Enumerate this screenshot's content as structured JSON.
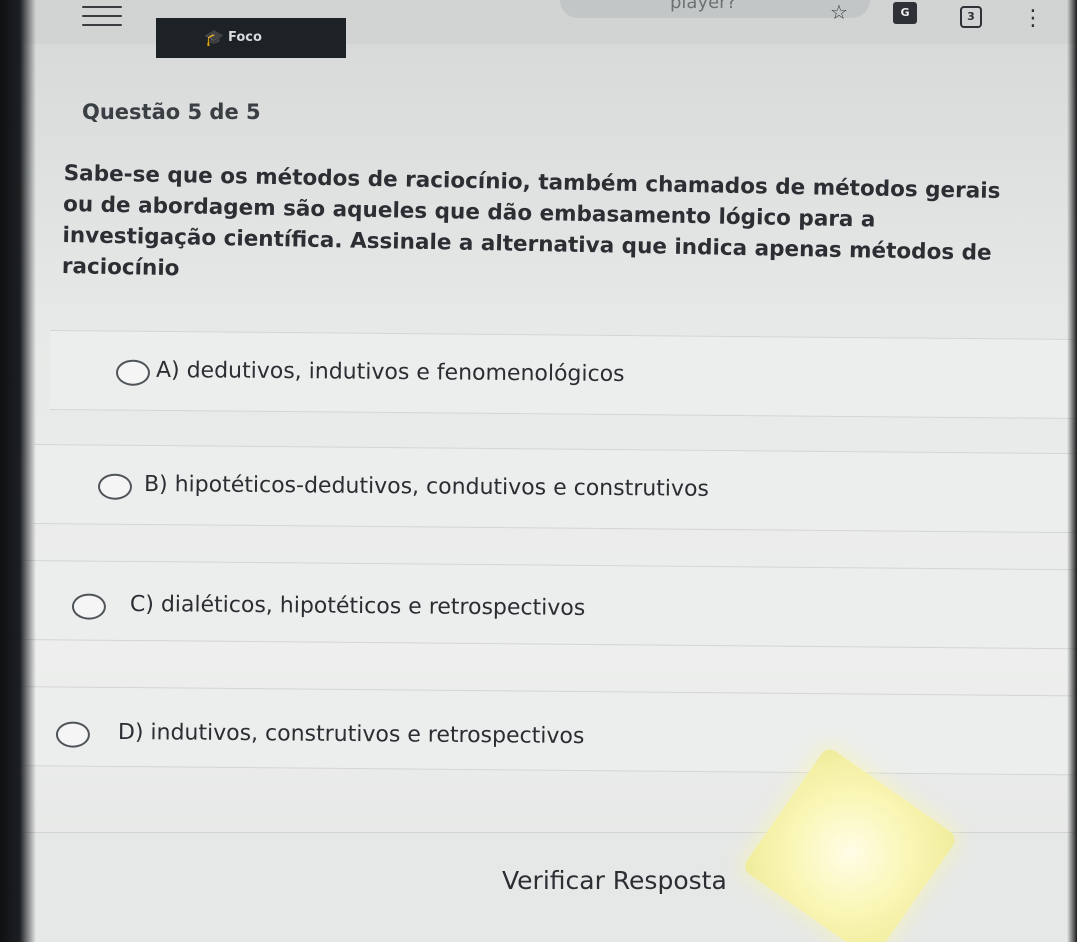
{
  "browser": {
    "url_fragment": "player?",
    "tab_count": "3",
    "translate_label": "G"
  },
  "header": {
    "logo_text": "Foco"
  },
  "question": {
    "number_label": "Questão 5 de 5",
    "text": "Sabe-se que os métodos de raciocínio, também chamados de métodos gerais\nou de abordagem são aqueles que dão embasamento lógico para a\ninvestigação científica. Assinale a alternativa que indica apenas métodos de\nraciocínio"
  },
  "options": [
    {
      "label": "A) dedutivos, indutivos e fenomenológicos"
    },
    {
      "label": "B) hipotéticos-dedutivos, condutivos e construtivos"
    },
    {
      "label": "C) dialéticos, hipotéticos e retrospectivos"
    },
    {
      "label": "D) indutivos, construtivos e retrospectivos"
    }
  ],
  "verify_button": {
    "label": "Verificar Resposta"
  },
  "icons": {
    "menu": "hamburger-icon",
    "bookmark": "star-icon",
    "translate": "translate-icon",
    "tabs": "tabs-icon",
    "more": "more-vertical-icon",
    "logo": "graduation-cap-icon"
  }
}
